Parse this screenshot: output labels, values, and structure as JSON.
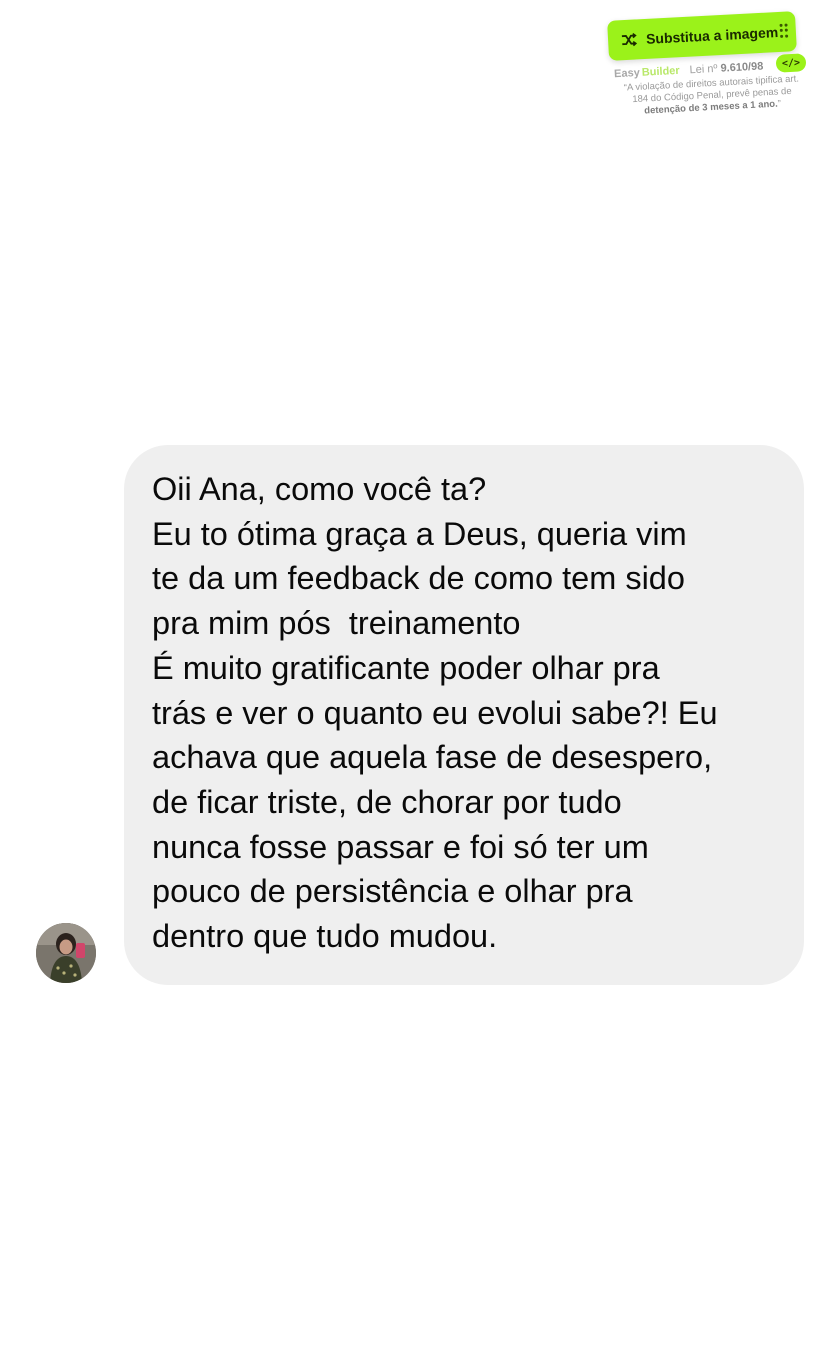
{
  "watermark": {
    "button_label": "Substitua a imagem",
    "brand_easy": "Easy",
    "brand_builder": "Builder",
    "law_prefix": "Lei nº",
    "law_number": "9.610/98",
    "code_icon_label": "</>",
    "legal_text_line1": "“A violação de direitos autorais tipifica art.",
    "legal_text_line2": "184 do Código Penal, prevê penas de",
    "legal_text_bold": "detenção de 3 meses a 1 ano.",
    "legal_text_end": "”",
    "accent_color": "#9bf21a"
  },
  "chat": {
    "message_lines": [
      "Oii Ana, como você ta?",
      "Eu to ótima graça a Deus, queria vim",
      "te da um feedback de como tem sido",
      "pra mim pós  treinamento",
      "É muito gratificante poder olhar pra",
      "trás e ver o quanto eu evolui sabe?! Eu",
      "achava que aquela fase de desespero,",
      "de ficar triste, de chorar por tudo",
      "nunca fosse passar e foi só ter um",
      "pouco de persistência e olhar pra",
      "dentro que tudo mudou."
    ],
    "bubble_color": "#efefef",
    "sender_avatar": "avatar-photo-icon"
  }
}
